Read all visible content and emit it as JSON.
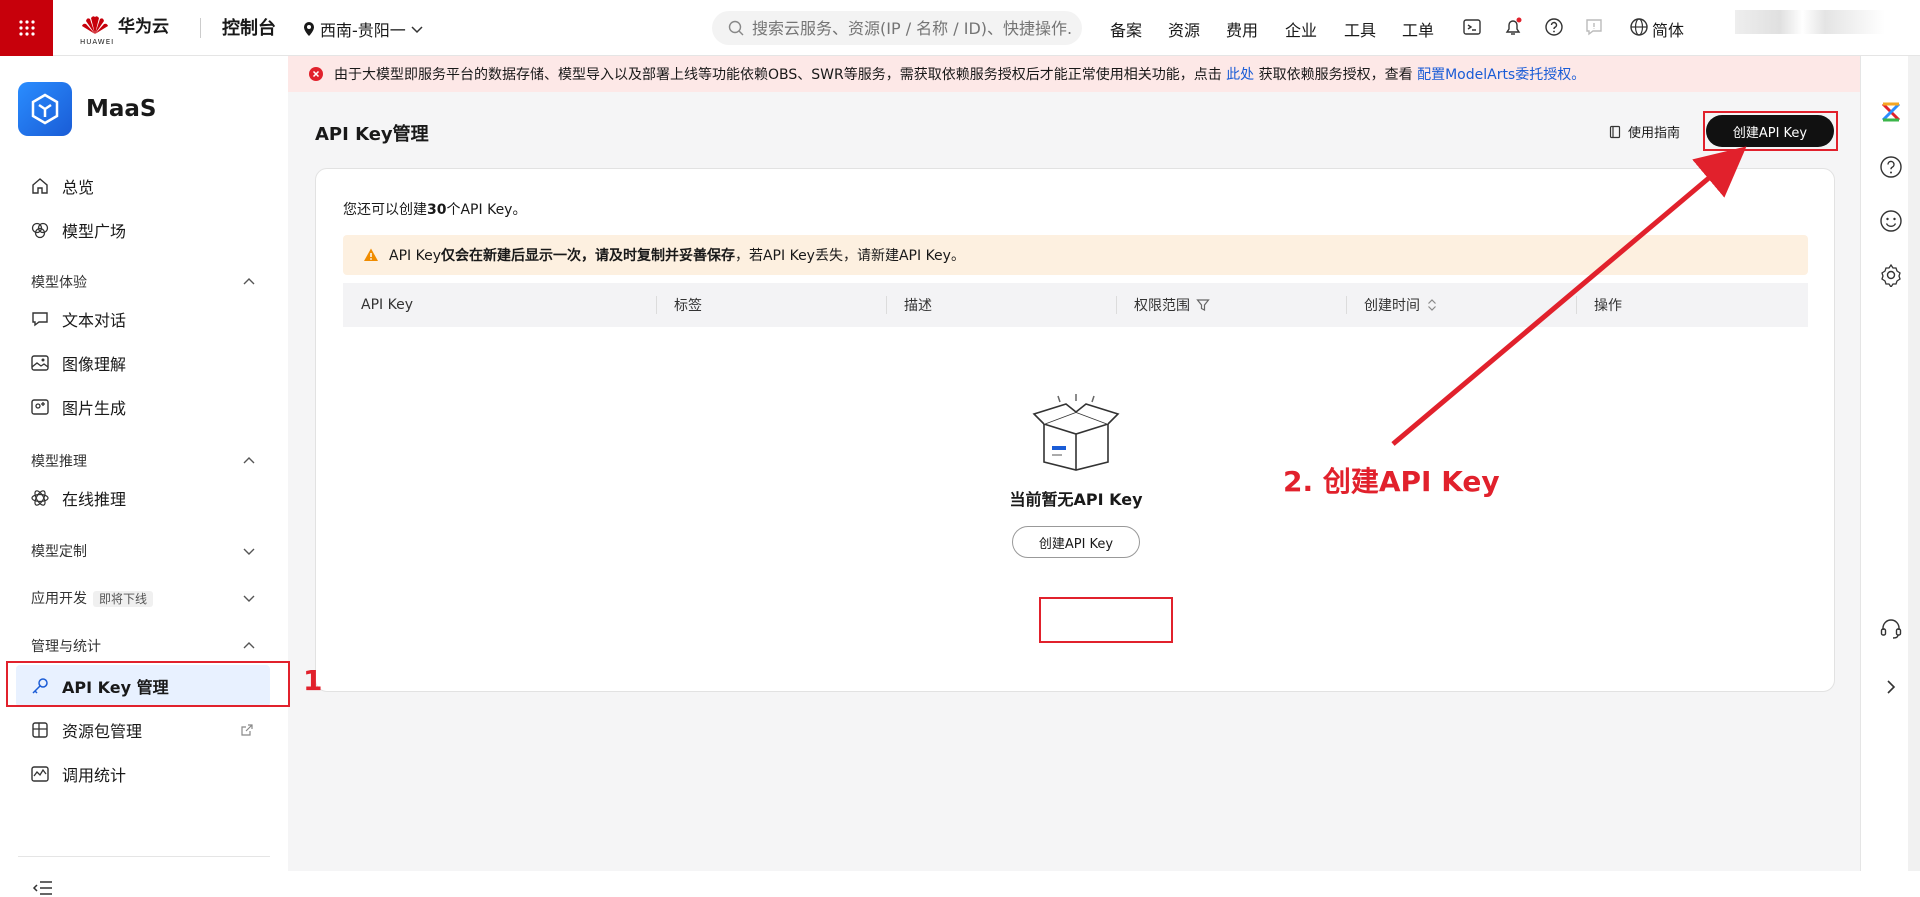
{
  "header": {
    "brand": "华为云",
    "brand_sub": "HUAWEI",
    "console": "控制台",
    "region": "西南-贵阳一",
    "search_placeholder": "搜索云服务、资源(IP / 名称 / ID)、快捷操作...",
    "nav": [
      "备案",
      "资源",
      "费用",
      "企业",
      "工具",
      "工单"
    ],
    "lang": "简体"
  },
  "sidebar": {
    "app_name": "MaaS",
    "items_top": [
      {
        "label": "总览",
        "icon": "home-icon"
      },
      {
        "label": "模型广场",
        "icon": "cube-icon"
      }
    ],
    "group_experience": "模型体验",
    "items_experience": [
      {
        "label": "文本对话",
        "icon": "chat-icon"
      },
      {
        "label": "图像理解",
        "icon": "image-icon"
      },
      {
        "label": "图片生成",
        "icon": "image-plus-icon"
      }
    ],
    "group_inference": "模型推理",
    "items_inference": [
      {
        "label": "在线推理",
        "icon": "atom-icon"
      }
    ],
    "group_custom": "模型定制",
    "group_appdev": "应用开发",
    "appdev_badge": "即将下线",
    "group_manage": "管理与统计",
    "items_manage": [
      {
        "label": "API Key 管理",
        "icon": "key-icon"
      },
      {
        "label": "资源包管理",
        "icon": "package-icon"
      },
      {
        "label": "调用统计",
        "icon": "chart-icon"
      }
    ]
  },
  "alert": {
    "text_before": "由于大模型即服务平台的数据存储、模型导入以及部署上线等功能依赖OBS、SWR等服务，需获取依赖服务授权后才能正常使用相关功能，点击",
    "link1": "此处",
    "text_mid": "获取依赖服务授权，查看",
    "link2": "配置ModelArts委托授权。"
  },
  "page": {
    "title": "API Key管理",
    "guide": "使用指南",
    "create_label": "创建API Key",
    "remain_prefix": "您还可以创建",
    "remain_count": "30",
    "remain_suffix": "个API Key。",
    "warn_prefix": "API Key",
    "warn_bold": "仅会在新建后显示一次，请及时复制并妥善保存",
    "warn_suffix": "，若API Key丢失，请新建API Key。",
    "columns": [
      "API Key",
      "标签",
      "描述",
      "权限范围",
      "创建时间",
      "操作"
    ],
    "empty_text": "当前暂无API Key",
    "empty_create": "创建API Key"
  },
  "annotations": {
    "step1": "1",
    "step2": "2. 创建API Key"
  },
  "colors": {
    "accent": "#e1212c",
    "brand_red": "#c7000b",
    "link": "#1a5cd6"
  }
}
